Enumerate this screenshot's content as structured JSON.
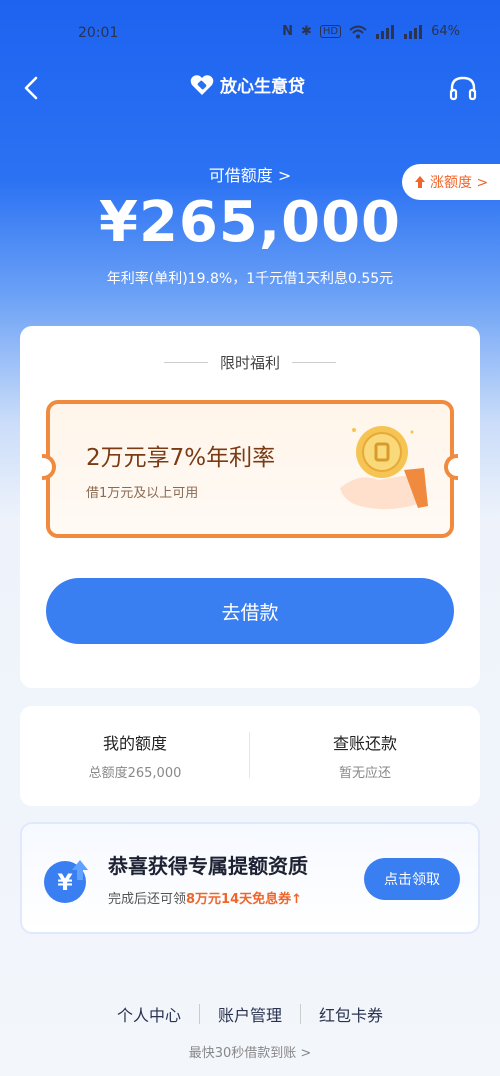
{
  "status_bar": {
    "time": "20:01",
    "nfc": "N",
    "bluetooth": "✱",
    "hd": "HD",
    "wifi": "📶",
    "signal1": "▮▮▮",
    "signal2": "▮▮▮",
    "battery": "64%"
  },
  "header": {
    "title": "放心生意贷",
    "back_icon": "chevron-left-icon",
    "headset_icon": "headset-icon",
    "logo_icon": "heart-logo-icon"
  },
  "credit": {
    "label": "可借额度 >",
    "amount": "¥265,000",
    "rate_info": "年利率(单利)19.8%，1千元借1天利息0.55元",
    "raise_limit": "涨额度 >"
  },
  "benefit": {
    "title": "限时福利",
    "coupon_title": "2万元享7%年利率",
    "coupon_subtitle": "借1万元及以上可用"
  },
  "borrow_button": "去借款",
  "quick": {
    "my_limit_title": "我的额度",
    "my_limit_sub": "总额度265,000",
    "bill_title": "查账还款",
    "bill_sub": "暂无应还"
  },
  "promo": {
    "title": "恭喜获得专属提额资质",
    "sub_prefix": "完成后还可领",
    "sub_highlight": "8万元14天免息券",
    "sub_arrow": "↑",
    "claim_button": "点击领取"
  },
  "footer": {
    "links": [
      "个人中心",
      "账户管理",
      "红包卡券"
    ],
    "note": "最快30秒借款到账 >"
  },
  "colors": {
    "primary": "#3a7ff1",
    "header_blue": "#1d63f0",
    "accent_orange": "#f0652a",
    "coupon_border": "#f08a3e"
  }
}
